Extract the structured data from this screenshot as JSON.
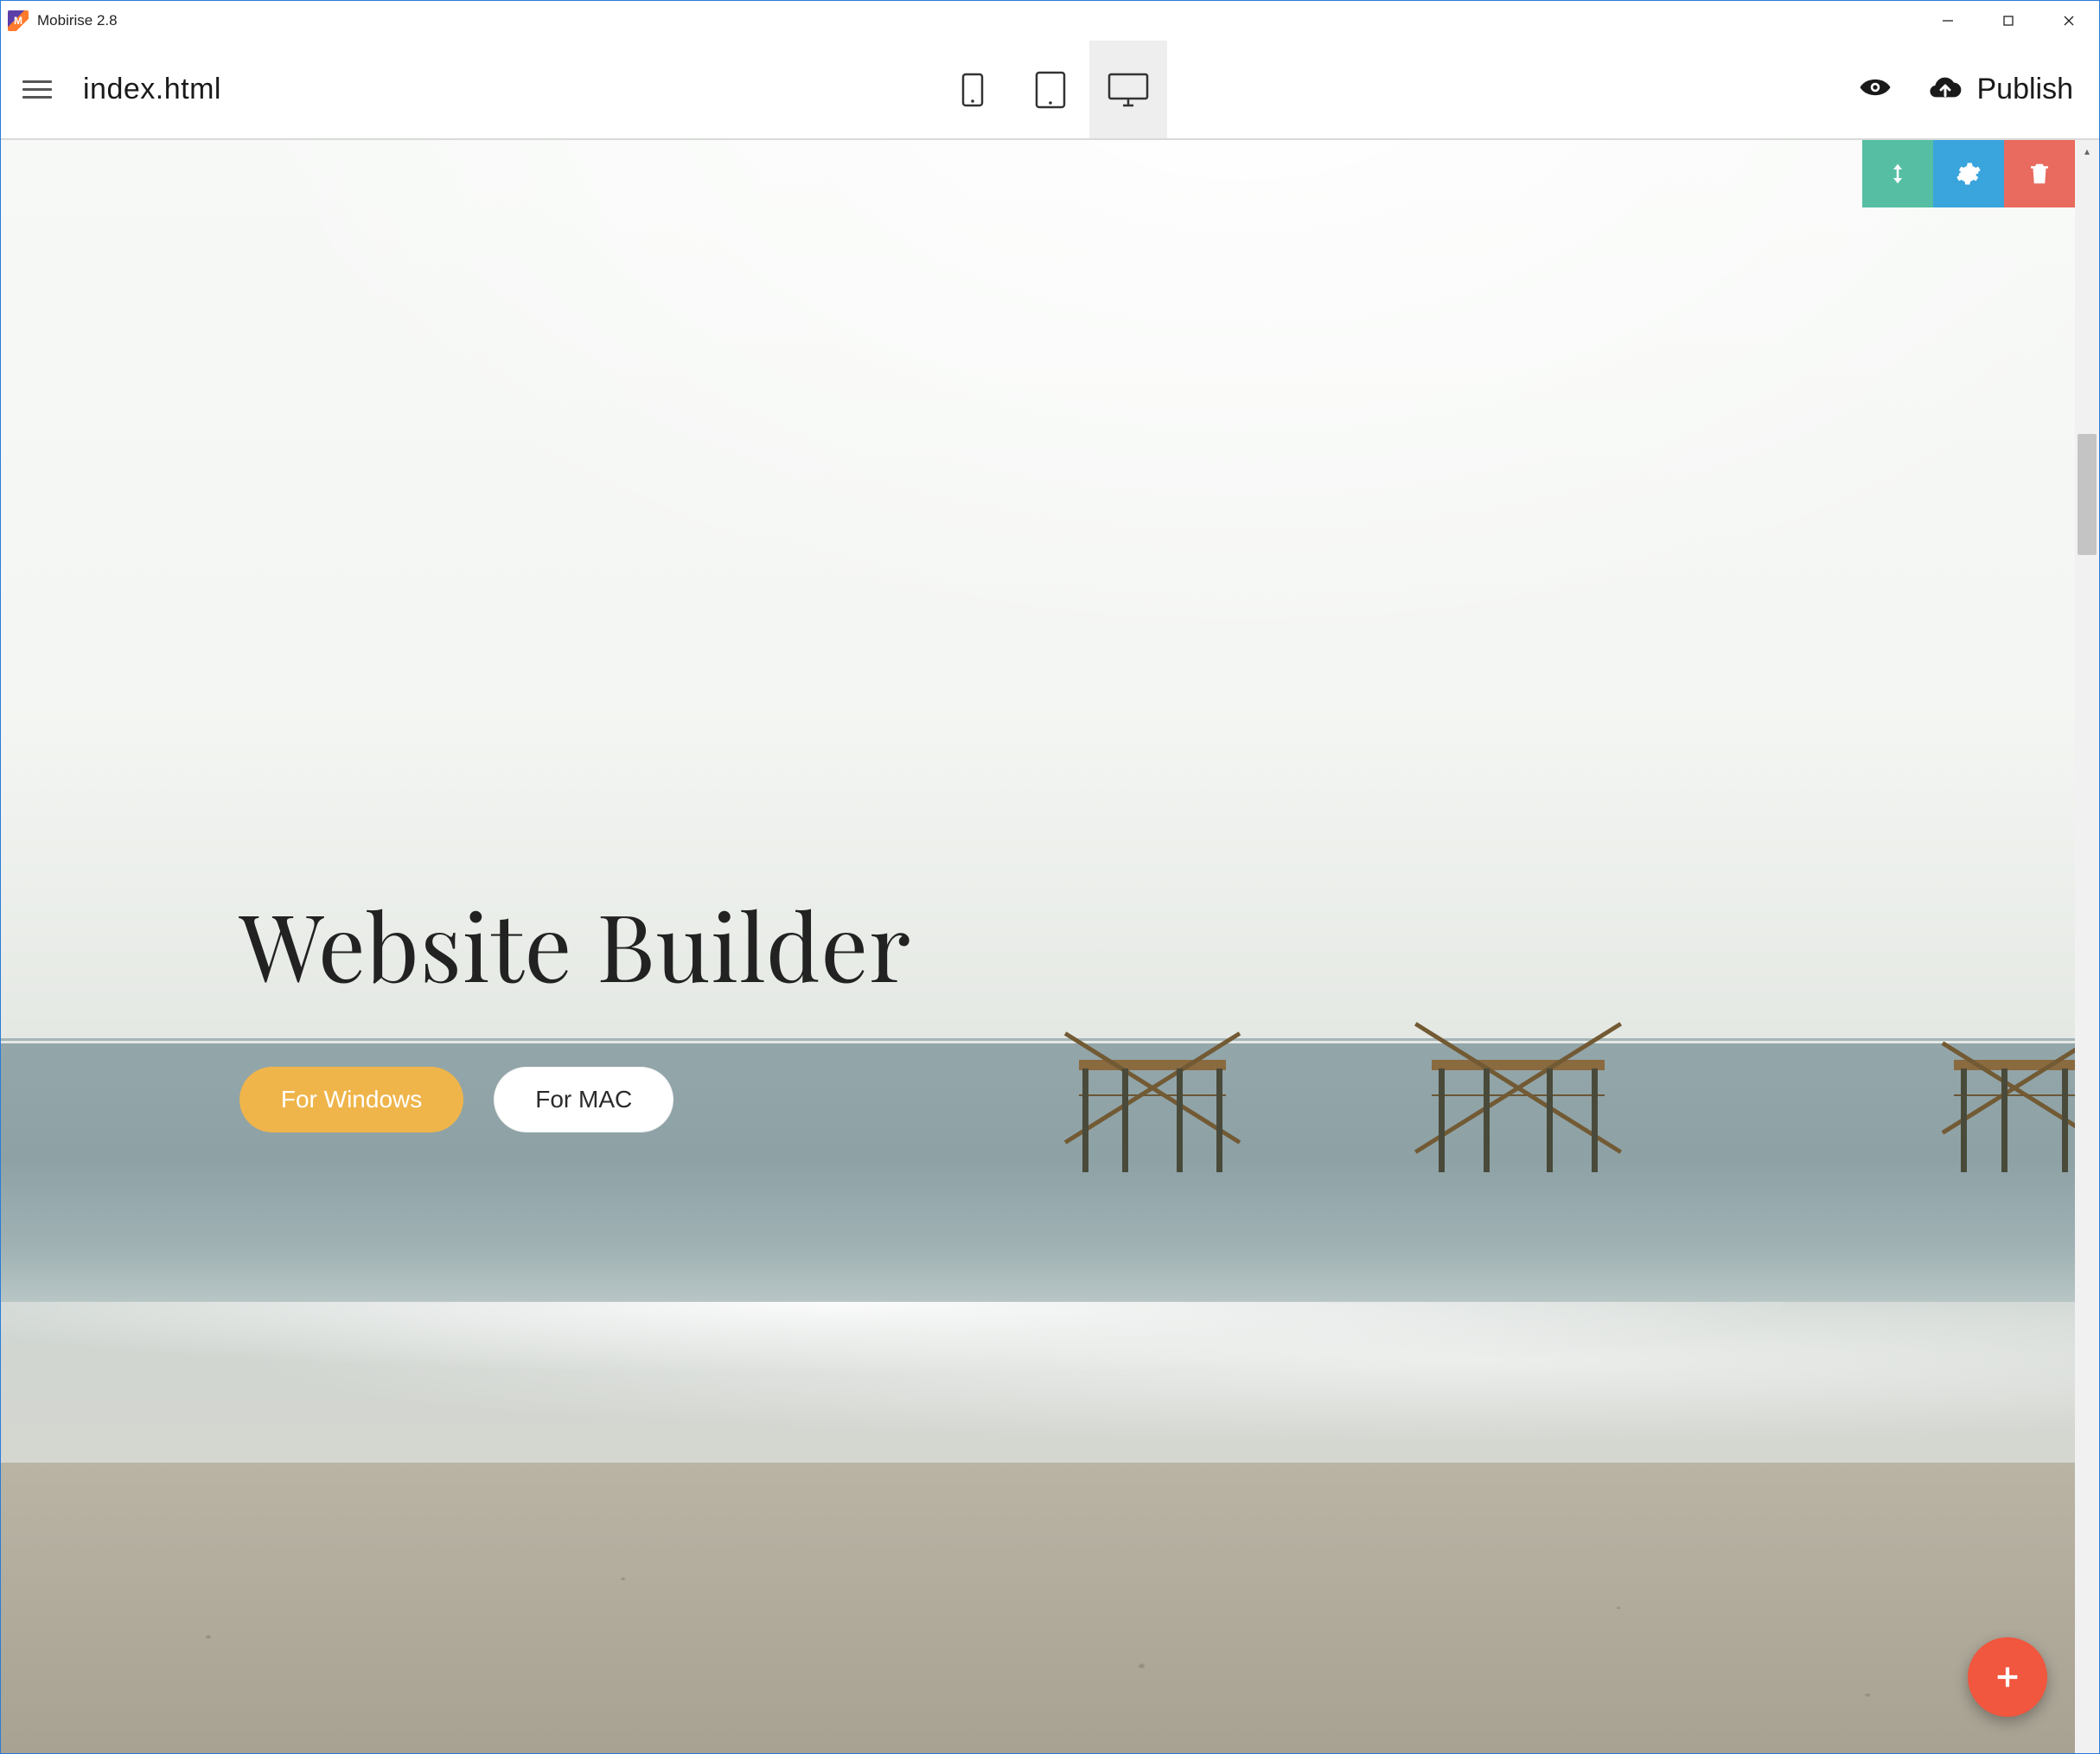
{
  "window": {
    "app_title": "Mobirise 2.8",
    "app_icon_letter": "M"
  },
  "toolbar": {
    "page_title": "index.html",
    "publish_label": "Publish",
    "devices": {
      "mobile": "mobile",
      "tablet": "tablet",
      "desktop": "desktop",
      "active": "desktop"
    }
  },
  "block_controls": {
    "move": "move",
    "settings": "settings",
    "delete": "delete"
  },
  "hero": {
    "title": "Website Builder",
    "buttons": {
      "primary": "For Windows",
      "secondary": "For MAC"
    }
  },
  "fab": {
    "label": "add-block"
  },
  "colors": {
    "accent_yellow": "#efb54b",
    "fab_red": "#f1563e",
    "bc_move": "#56bfa3",
    "bc_settings": "#3aa4dc",
    "bc_delete": "#e96a5e"
  }
}
